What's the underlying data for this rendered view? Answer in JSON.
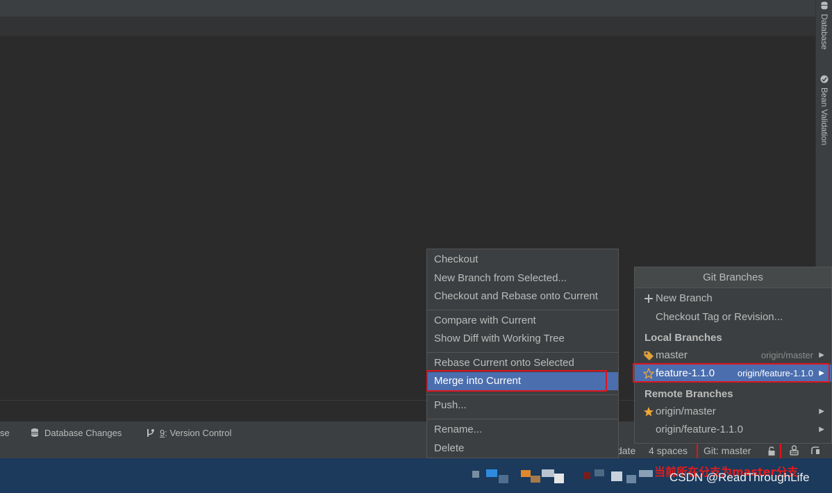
{
  "right_tools": [
    {
      "label": "Database",
      "icon": "database-icon"
    },
    {
      "label": "Bean Validation",
      "icon": "bean-validation-icon"
    }
  ],
  "tool_window_bar": {
    "truncated": "se",
    "database_changes": "Database Changes",
    "version_control_prefix": "9",
    "version_control_label": ": Version Control"
  },
  "status_bar": {
    "truncated_update": "date",
    "indent": "4 spaces",
    "git_branch": "Git: master"
  },
  "context_menu": {
    "items": [
      "Checkout",
      "New Branch from Selected...",
      "Checkout and Rebase onto Current",
      "Compare with Current",
      "Show Diff with Working Tree",
      "Rebase Current onto Selected",
      "Merge into Current",
      "Push...",
      "Rename...",
      "Delete"
    ],
    "selected": "Merge into Current"
  },
  "git_branches": {
    "title": "Git Branches",
    "new_branch": "New Branch",
    "checkout_tag": "Checkout Tag or Revision...",
    "local_header": "Local Branches",
    "local": [
      {
        "name": "master",
        "tracking": "origin/master",
        "icon": "tag-icon"
      },
      {
        "name": "feature-1.1.0",
        "tracking": "origin/feature-1.1.0",
        "icon": "star-outline-icon",
        "selected": true
      }
    ],
    "remote_header": "Remote Branches",
    "remote": [
      {
        "name": "origin/master",
        "icon": "star-filled-icon"
      },
      {
        "name": "origin/feature-1.1.0",
        "icon": ""
      }
    ]
  },
  "annotation": "当前所在分支为master分支",
  "watermark": "CSDN @ReadThroughLife",
  "colors": {
    "selection": "#4b6eaf",
    "highlight_box": "#e0141e",
    "menu_bg": "#3c3f41",
    "editor_bg": "#2b2b2b",
    "star": "#f0a732"
  }
}
